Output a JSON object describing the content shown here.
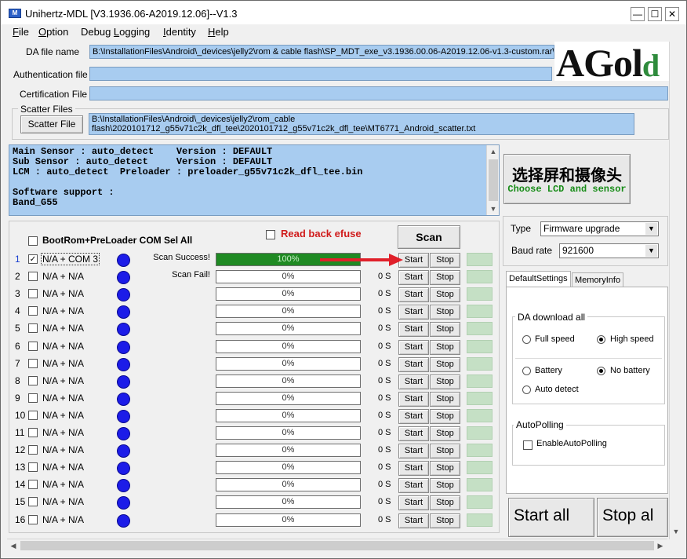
{
  "window": {
    "title": "Unihertz-MDL [V3.1936.06-A2019.12.06]--V1.3",
    "icon": "app-icon",
    "controls": {
      "minimize": "—",
      "maximize": "☐",
      "close": "✕"
    }
  },
  "menu": [
    {
      "first": "F",
      "rest": "ile"
    },
    {
      "first": "O",
      "rest": "ption"
    },
    {
      "first": "",
      "rest": "Debug ",
      "first2": "L",
      "rest2": "ogging"
    },
    {
      "first": "I",
      "rest": "dentity"
    },
    {
      "first": "H",
      "rest": "elp"
    }
  ],
  "da_file": {
    "label": "DA file name",
    "value": "B:\\InstallationFiles\\Android\\_devices\\jelly2\\rom & cable flash\\SP_MDT_exe_v3.1936.00.06-A2019.12.06-v1.3-custom.rar\\S"
  },
  "authentication_file": {
    "label": "Authentication file",
    "value": ""
  },
  "certification_file": {
    "label": "Certification File",
    "value": ""
  },
  "scatter": {
    "group_label": "Scatter Files",
    "button_label": "Scatter File",
    "line1": "B:\\InstallationFiles\\Android\\_devices\\jelly2\\rom_cable",
    "line2": "flash\\2020101712_g55v71c2k_dfl_tee\\2020101712_g55v71c2k_dfl_tee\\MT6771_Android_scatter.txt"
  },
  "logo": {
    "text_big": "AGol",
    "text_small": "d"
  },
  "info_lines": [
    "Main Sensor : auto_detect    Version : DEFAULT",
    "Sub Sensor : auto_detect     Version : DEFAULT",
    "LCM : auto_detect  Preloader : preloader_g55v71c2k_dfl_tee.bin",
    "",
    "Software support :",
    "Band_G55"
  ],
  "lcd_button": {
    "main": "选择屏和摄像头",
    "sub": "Choose LCD and sensor"
  },
  "device_panel": {
    "bootrom_label": "BootRom+PreLoader COM Sel All",
    "read_back_label": "Read back efuse",
    "scan_label": "Scan",
    "start_label": "Start",
    "stop_label": "Stop"
  },
  "rows": [
    {
      "num": "1",
      "checked": true,
      "port": "N/A + COM 3",
      "status": "Scan Success!",
      "progress": 100,
      "progress_text": "100%",
      "time": ""
    },
    {
      "num": "2",
      "checked": false,
      "port": "N/A + N/A",
      "status": "Scan Fail!",
      "progress": 0,
      "progress_text": "0%",
      "time": "0 S"
    },
    {
      "num": "3",
      "checked": false,
      "port": "N/A + N/A",
      "status": "",
      "progress": 0,
      "progress_text": "0%",
      "time": "0 S"
    },
    {
      "num": "4",
      "checked": false,
      "port": "N/A + N/A",
      "status": "",
      "progress": 0,
      "progress_text": "0%",
      "time": "0 S"
    },
    {
      "num": "5",
      "checked": false,
      "port": "N/A + N/A",
      "status": "",
      "progress": 0,
      "progress_text": "0%",
      "time": "0 S"
    },
    {
      "num": "6",
      "checked": false,
      "port": "N/A + N/A",
      "status": "",
      "progress": 0,
      "progress_text": "0%",
      "time": "0 S"
    },
    {
      "num": "7",
      "checked": false,
      "port": "N/A + N/A",
      "status": "",
      "progress": 0,
      "progress_text": "0%",
      "time": "0 S"
    },
    {
      "num": "8",
      "checked": false,
      "port": "N/A + N/A",
      "status": "",
      "progress": 0,
      "progress_text": "0%",
      "time": "0 S"
    },
    {
      "num": "9",
      "checked": false,
      "port": "N/A + N/A",
      "status": "",
      "progress": 0,
      "progress_text": "0%",
      "time": "0 S"
    },
    {
      "num": "10",
      "checked": false,
      "port": "N/A + N/A",
      "status": "",
      "progress": 0,
      "progress_text": "0%",
      "time": "0 S"
    },
    {
      "num": "11",
      "checked": false,
      "port": "N/A + N/A",
      "status": "",
      "progress": 0,
      "progress_text": "0%",
      "time": "0 S"
    },
    {
      "num": "12",
      "checked": false,
      "port": "N/A + N/A",
      "status": "",
      "progress": 0,
      "progress_text": "0%",
      "time": "0 S"
    },
    {
      "num": "13",
      "checked": false,
      "port": "N/A + N/A",
      "status": "",
      "progress": 0,
      "progress_text": "0%",
      "time": "0 S"
    },
    {
      "num": "14",
      "checked": false,
      "port": "N/A + N/A",
      "status": "",
      "progress": 0,
      "progress_text": "0%",
      "time": "0 S"
    },
    {
      "num": "15",
      "checked": false,
      "port": "N/A + N/A",
      "status": "",
      "progress": 0,
      "progress_text": "0%",
      "time": "0 S"
    },
    {
      "num": "16",
      "checked": false,
      "port": "N/A + N/A",
      "status": "",
      "progress": 0,
      "progress_text": "0%",
      "time": "0 S"
    }
  ],
  "settings": {
    "type_label": "Type",
    "type_value": "Firmware upgrade",
    "baud_label": "Baud rate",
    "baud_value": "921600",
    "tabs": [
      "DefaultSettings",
      "MemoryInfo"
    ],
    "da_group_label": "DA download all",
    "full_speed": "Full speed",
    "high_speed": "High speed",
    "battery": "Battery",
    "no_battery": "No battery",
    "auto_detect": "Auto detect",
    "autopolling_group_label": "AutoPolling",
    "enable_autopolling": "EnableAutoPolling"
  },
  "start_all_label": "Start all",
  "stop_all_label": "Stop al",
  "colors": {
    "field_blue": "#a8ccf0",
    "progress_green": "#1f8a23",
    "dot_blue": "#1c1ce8",
    "result_green": "#c5e0c5",
    "read_back_red": "#d01c1c",
    "arrow_red": "#e0202a"
  }
}
